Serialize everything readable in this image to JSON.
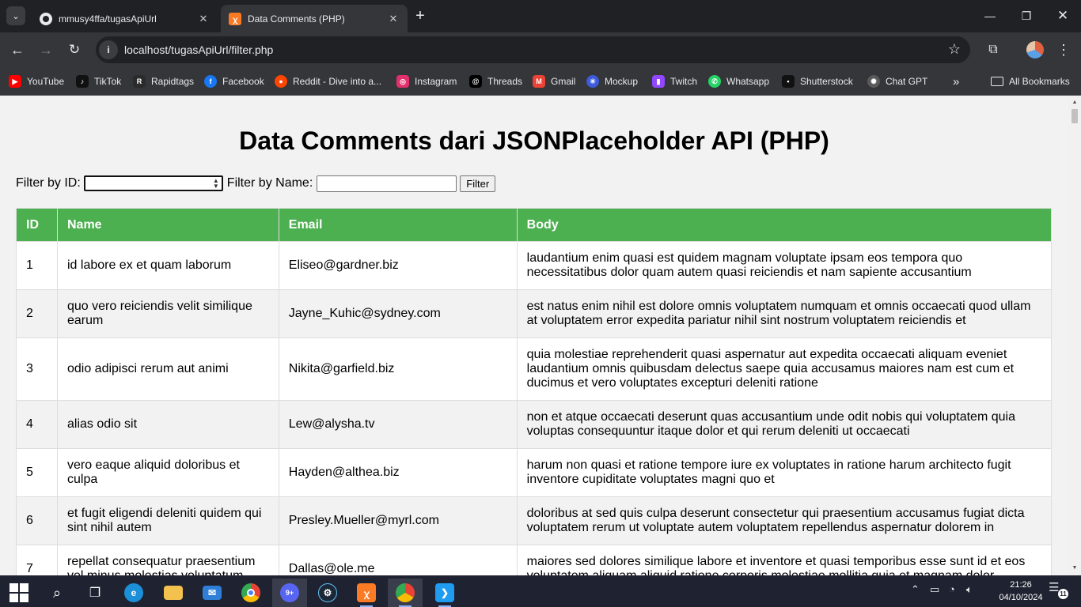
{
  "browser": {
    "tabs": [
      {
        "title": "mmusy4ffa/tugasApiUrl",
        "favicon": "github-icon",
        "active": false
      },
      {
        "title": "Data Comments (PHP)",
        "favicon": "xampp-icon",
        "active": true
      }
    ],
    "url": "localhost/tugasApiUrl/filter.php",
    "bookmarks": [
      {
        "label": "YouTube",
        "icon": "youtube-icon",
        "color": "#ff0000"
      },
      {
        "label": "TikTok",
        "icon": "tiktok-icon",
        "color": "#111111"
      },
      {
        "label": "Rapidtags",
        "icon": "rapidtags-icon",
        "color": "#2b2b2b"
      },
      {
        "label": "Facebook",
        "icon": "facebook-icon",
        "color": "#1877f2"
      },
      {
        "label": "Reddit - Dive into a...",
        "icon": "reddit-icon",
        "color": "#ff4500"
      },
      {
        "label": "Instagram",
        "icon": "instagram-icon",
        "color": "#e1306c"
      },
      {
        "label": "Threads",
        "icon": "threads-icon",
        "color": "#000000"
      },
      {
        "label": "Gmail",
        "icon": "gmail-icon",
        "color": "#ea4335"
      },
      {
        "label": "Mockup",
        "icon": "mockup-icon",
        "color": "#3b5bdb"
      },
      {
        "label": "Twitch",
        "icon": "twitch-icon",
        "color": "#9146ff"
      },
      {
        "label": "Whatsapp",
        "icon": "whatsapp-icon",
        "color": "#25d366"
      },
      {
        "label": "Shutterstock",
        "icon": "shutterstock-icon",
        "color": "#111111"
      },
      {
        "label": "Chat GPT",
        "icon": "chatgpt-icon",
        "color": "#5a5a5a"
      }
    ],
    "all_bookmarks": "All Bookmarks"
  },
  "page": {
    "title": "Data Comments dari JSONPlaceholder API (PHP)",
    "filter_id_label": "Filter by ID:",
    "filter_id_value": "",
    "filter_name_label": "Filter by Name:",
    "filter_name_value": "",
    "filter_button": "Filter",
    "accent_color": "#4caf50",
    "table": {
      "headers": [
        "ID",
        "Name",
        "Email",
        "Body"
      ],
      "rows": [
        {
          "id": "1",
          "name": "id labore ex et quam laborum",
          "email": "Eliseo@gardner.biz",
          "body": "laudantium enim quasi est quidem magnam voluptate ipsam eos tempora quo necessitatibus dolor quam autem quasi reiciendis et nam sapiente accusantium"
        },
        {
          "id": "2",
          "name": "quo vero reiciendis velit similique earum",
          "email": "Jayne_Kuhic@sydney.com",
          "body": "est natus enim nihil est dolore omnis voluptatem numquam et omnis occaecati quod ullam at voluptatem error expedita pariatur nihil sint nostrum voluptatem reiciendis et"
        },
        {
          "id": "3",
          "name": "odio adipisci rerum aut animi",
          "email": "Nikita@garfield.biz",
          "body": "quia molestiae reprehenderit quasi aspernatur aut expedita occaecati aliquam eveniet laudantium omnis quibusdam delectus saepe quia accusamus maiores nam est cum et ducimus et vero voluptates excepturi deleniti ratione"
        },
        {
          "id": "4",
          "name": "alias odio sit",
          "email": "Lew@alysha.tv",
          "body": "non et atque occaecati deserunt quas accusantium unde odit nobis qui voluptatem quia voluptas consequuntur itaque dolor et qui rerum deleniti ut occaecati"
        },
        {
          "id": "5",
          "name": "vero eaque aliquid doloribus et culpa",
          "email": "Hayden@althea.biz",
          "body": "harum non quasi et ratione tempore iure ex voluptates in ratione harum architecto fugit inventore cupiditate voluptates magni quo et"
        },
        {
          "id": "6",
          "name": "et fugit eligendi deleniti quidem qui sint nihil autem",
          "email": "Presley.Mueller@myrl.com",
          "body": "doloribus at sed quis culpa deserunt consectetur qui praesentium accusamus fugiat dicta voluptatem rerum ut voluptate autem voluptatem repellendus aspernatur dolorem in"
        },
        {
          "id": "7",
          "name": "repellat consequatur praesentium vel minus molestias voluptatum",
          "email": "Dallas@ole.me",
          "body": "maiores sed dolores similique labore et inventore et quasi temporibus esse sunt id et eos voluptatem aliquam aliquid ratione corporis molestiae mollitia quia et magnam dolor"
        }
      ]
    }
  },
  "taskbar": {
    "apps": [
      "windows-start-icon",
      "search-icon",
      "task-view-icon",
      "edge-icon",
      "file-explorer-icon",
      "mail-icon",
      "chrome-icon",
      "discord-icon",
      "steam-icon",
      "xampp-icon",
      "chrome-profile-icon",
      "vscode-icon"
    ],
    "discord_badge": "9+",
    "time": "21:26",
    "date": "04/10/2024",
    "notification_count": "11"
  }
}
